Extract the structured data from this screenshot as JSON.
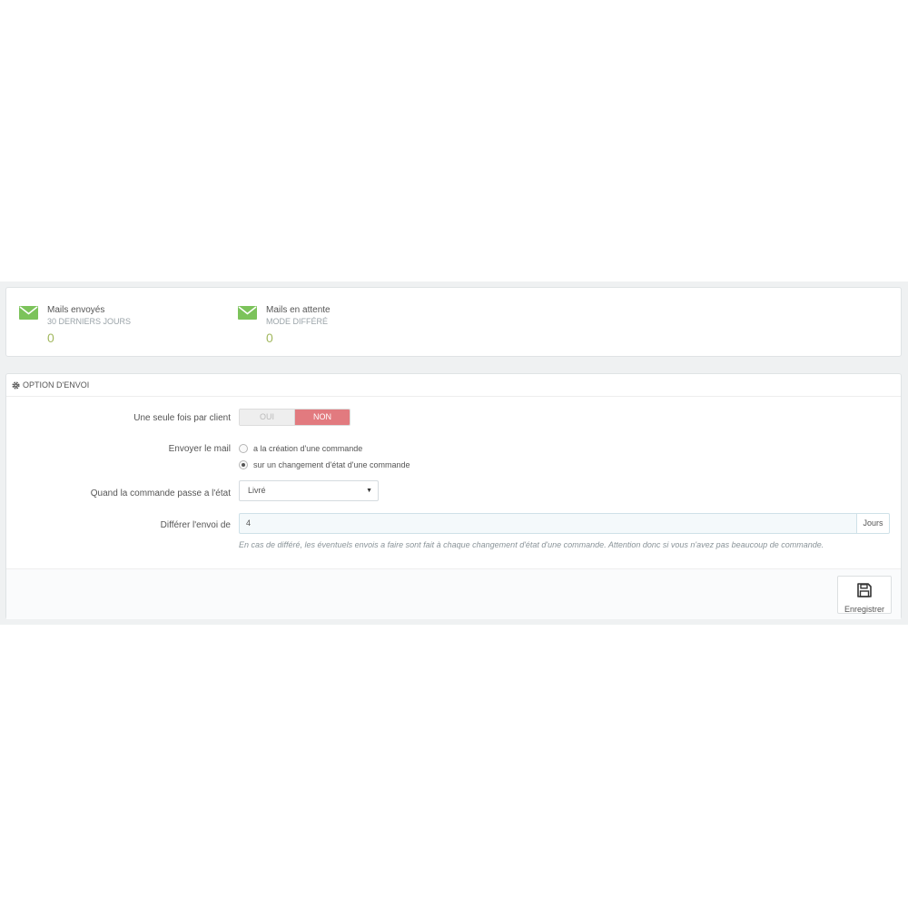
{
  "kpis": [
    {
      "title": "Mails envoyés",
      "subtitle": "30 DERNIERS JOURS",
      "value": "0",
      "icon": "envelope-icon"
    },
    {
      "title": "Mails en attente",
      "subtitle": "MODE DIFFÉRÉ",
      "value": "0",
      "icon": "envelope-icon"
    }
  ],
  "colors": {
    "kpi_icon": "#7cc35b",
    "kpi_value": "#a2b85f",
    "toggle_active": "#e27a7f"
  },
  "options": {
    "heading": "OPTION D'ENVOI",
    "once_per_client": {
      "label": "Une seule fois par client",
      "yes": "OUI",
      "no": "NON",
      "selected": "NON"
    },
    "send_mail": {
      "label": "Envoyer le mail",
      "choices": [
        "a la création d'une commande",
        "sur un changement d'état d'une commande"
      ],
      "selected_index": 1
    },
    "state": {
      "label": "Quand la commande passe a l'état",
      "value": "Livré"
    },
    "delay": {
      "label": "Différer l'envoi de",
      "value": "4",
      "unit": "Jours",
      "help": "En cas de différé, les éventuels envois a faire sont fait à chaque changement d'état d'une commande. Attention donc si vous n'avez pas beaucoup de commande."
    },
    "save_label": "Enregistrer"
  }
}
